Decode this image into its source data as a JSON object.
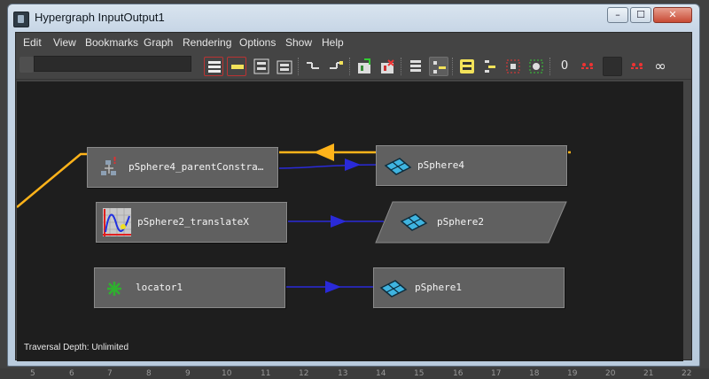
{
  "window": {
    "title": "Hypergraph InputOutput1",
    "controls": {
      "minimize": "–",
      "maximize": "☐",
      "close": "✕"
    }
  },
  "menu": [
    "Edit",
    "View",
    "Bookmarks",
    "Graph",
    "Rendering",
    "Options",
    "Show",
    "Help"
  ],
  "toolbar": {
    "field_value": "",
    "buttons": [
      "scene-hierarchy-icon",
      "input-output-icon",
      "freeform-layout-icon",
      "automatic-layout-icon",
      "input-connections-icon",
      "output-connections-icon",
      "add-selected-icon",
      "remove-selected-icon",
      "display-options-icon",
      "swatch-toggle-icon",
      "bookmark-icon",
      "bookmark-remove-icon",
      "frame-selection-icon",
      "frame-all-icon",
      "zero-icon",
      "no-history-icon",
      "blank-slot",
      "remove-history-icon",
      "infinite-icon"
    ],
    "glyphs": {
      "zero": "0",
      "infinite": "∞"
    }
  },
  "nodes": [
    {
      "id": "parent-constraint",
      "label": "pSphere4_parentConstra…",
      "icon": "parent-constraint-icon"
    },
    {
      "id": "psphere4",
      "label": "pSphere4",
      "icon": "mesh-icon"
    },
    {
      "id": "translatex",
      "label": "pSphere2_translateX",
      "icon": "anim-curve-icon"
    },
    {
      "id": "psphere2",
      "label": "pSphere2",
      "icon": "mesh-icon"
    },
    {
      "id": "locator1",
      "label": "locator1",
      "icon": "locator-icon"
    },
    {
      "id": "psphere1",
      "label": "pSphere1",
      "icon": "mesh-icon"
    }
  ],
  "status": "Traversal Depth: Unlimited",
  "ruler": [
    "5",
    "6",
    "7",
    "8",
    "9",
    "10",
    "11",
    "12",
    "13",
    "14",
    "15",
    "16",
    "17",
    "18",
    "19",
    "20",
    "21",
    "22"
  ],
  "colors": {
    "edge_blue": "#2a2ad8",
    "edge_orange": "#ffb31a",
    "node_bg": "#606060",
    "graph_bg": "#1e1e1e"
  }
}
